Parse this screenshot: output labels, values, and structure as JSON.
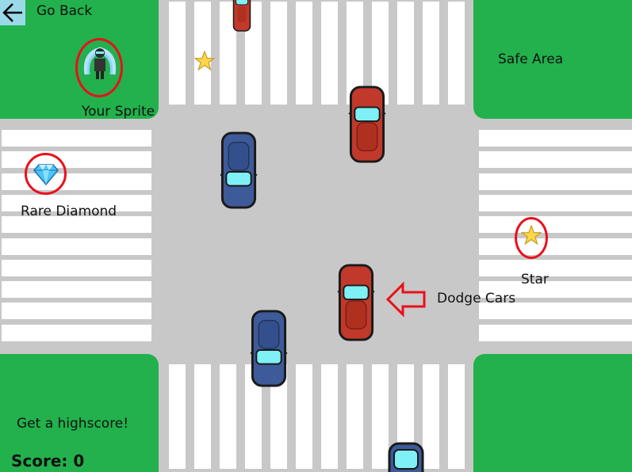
{
  "nav": {
    "back_label": "Go Back"
  },
  "labels": {
    "sprite": "Your Sprite",
    "diamond": "Rare Diamond",
    "safe": "Safe Area",
    "star": "Star",
    "dodge": "Dodge Cars",
    "highscore": "Get a highscore!"
  },
  "score": {
    "label": "Score:",
    "value": 0,
    "text": "Score: 0"
  },
  "icons": {
    "back": "arrow-left-icon",
    "sprite": "player-sprite",
    "diamond": "diamond-icon",
    "star": "star-icon",
    "hint_arrow": "arrow-left-outline-icon"
  },
  "cars": [
    {
      "id": "red-car-top",
      "color": "red",
      "direction": "down"
    },
    {
      "id": "red-car-upper-lane",
      "color": "red",
      "direction": "down"
    },
    {
      "id": "blue-car-upper",
      "color": "blue",
      "direction": "up"
    },
    {
      "id": "red-car-lower",
      "color": "red",
      "direction": "down"
    },
    {
      "id": "blue-car-lower",
      "color": "blue",
      "direction": "up"
    },
    {
      "id": "blue-car-bottom",
      "color": "blue",
      "direction": "up"
    }
  ],
  "colors": {
    "grass": "#22b14c",
    "road": "#c8c8c8",
    "crosswalk": "#ffffff",
    "highlight_ring": "#e8101b",
    "back_button_bg": "#99d9ea",
    "car_red": "#c0392b",
    "car_blue": "#3d5a99",
    "car_glass": "#7ff0f5"
  }
}
